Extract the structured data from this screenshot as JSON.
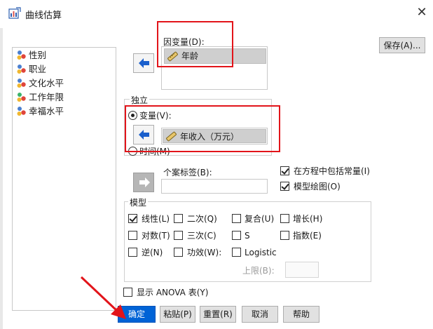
{
  "window": {
    "title": "曲线估算",
    "close_glyph": "✕"
  },
  "variables": [
    {
      "name": "性别",
      "icon": "nominal-variable-icon"
    },
    {
      "name": "职业",
      "icon": "nominal-variable-icon"
    },
    {
      "name": "文化水平",
      "icon": "nominal-variable-icon"
    },
    {
      "name": "工作年限",
      "icon": "ordinal-variable-icon"
    },
    {
      "name": "幸福水平",
      "icon": "nominal-variable-icon"
    }
  ],
  "dependent": {
    "label": "因变量(D):",
    "items": [
      "年龄"
    ]
  },
  "save_button": "保存(A)...",
  "independent": {
    "group_label": "独立",
    "variable_radio_label": "变量(V):",
    "variable_value": "年收入（万元）",
    "time_radio_label": "时间(M)",
    "selected": "variable"
  },
  "case_label": {
    "label": "个案标签(B):",
    "value": ""
  },
  "options": {
    "include_constant": {
      "label": "在方程中包括常量(I)",
      "checked": true
    },
    "plot_models": {
      "label": "模型绘图(O)",
      "checked": true
    }
  },
  "models": {
    "group_label": "模型",
    "items": [
      {
        "label": "线性(L)",
        "checked": true
      },
      {
        "label": "二次(Q)",
        "checked": false
      },
      {
        "label": "复合(U)",
        "checked": false
      },
      {
        "label": "增长(H)",
        "checked": false
      },
      {
        "label": "对数(T)",
        "checked": false
      },
      {
        "label": "三次(C)",
        "checked": false
      },
      {
        "label": "S",
        "checked": false
      },
      {
        "label": "指数(E)",
        "checked": false
      },
      {
        "label": "逆(N)",
        "checked": false
      },
      {
        "label": "功效(W):",
        "checked": false
      },
      {
        "label": "Logistic",
        "checked": false
      }
    ],
    "upper_bound_label": "上限(B):",
    "upper_bound_value": ""
  },
  "anova": {
    "label": "显示 ANOVA 表(Y)",
    "checked": false
  },
  "buttons": {
    "ok": "确定",
    "paste": "粘贴(P)",
    "reset": "重置(R)",
    "cancel": "取消",
    "help": "帮助"
  },
  "colors": {
    "highlight_red": "#e2141a",
    "primary_blue": "#0063d6",
    "arrow_blue": "#1a5fcc"
  }
}
